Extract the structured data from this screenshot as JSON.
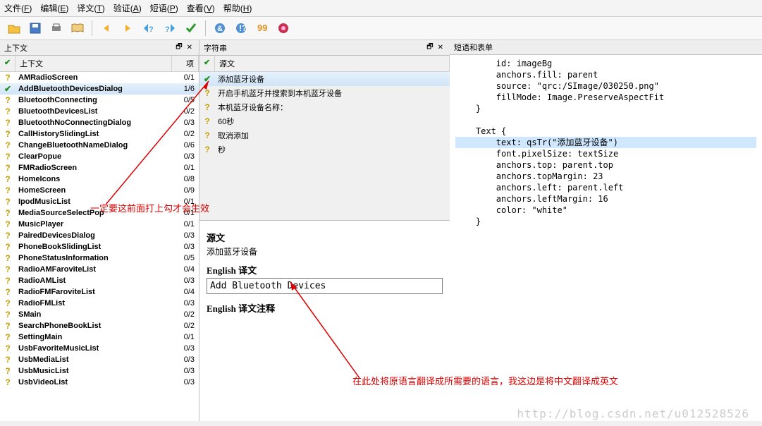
{
  "menu": [
    "文件(F)",
    "编辑(E)",
    "译文(T)",
    "验证(A)",
    "短语(P)",
    "查看(V)",
    "帮助(H)"
  ],
  "panels": {
    "context": {
      "title": "上下文",
      "col_icon": "",
      "col_name": "上下文",
      "col_items": "项"
    },
    "strings": {
      "title": "字符串",
      "col_icon": "",
      "col_name": "源文"
    },
    "right": {
      "title": "短语和表单"
    }
  },
  "context_rows": [
    {
      "icon": "q",
      "name": "AMRadioScreen",
      "items": "0/1"
    },
    {
      "icon": "c",
      "name": "AddBluetoothDevicesDialog",
      "items": "1/6",
      "sel": true
    },
    {
      "icon": "q",
      "name": "BluetoothConnecting",
      "items": "0/5"
    },
    {
      "icon": "q",
      "name": "BluetoothDevicesList",
      "items": "0/2"
    },
    {
      "icon": "q",
      "name": "BluetoothNoConnectingDialog",
      "items": "0/3"
    },
    {
      "icon": "q",
      "name": "CallHistorySlidingList",
      "items": "0/2"
    },
    {
      "icon": "q",
      "name": "ChangeBluetoothNameDialog",
      "items": "0/6"
    },
    {
      "icon": "q",
      "name": "ClearPopue",
      "items": "0/3"
    },
    {
      "icon": "q",
      "name": "FMRadioScreen",
      "items": "0/1"
    },
    {
      "icon": "q",
      "name": "HomeIcons",
      "items": "0/8"
    },
    {
      "icon": "q",
      "name": "HomeScreen",
      "items": "0/9"
    },
    {
      "icon": "q",
      "name": "IpodMusicList",
      "items": "0/1"
    },
    {
      "icon": "q",
      "name": "MediaSourceSelectPop",
      "items": "0/1"
    },
    {
      "icon": "q",
      "name": "MusicPlayer",
      "items": "0/1"
    },
    {
      "icon": "q",
      "name": "PairedDevicesDialog",
      "items": "0/3"
    },
    {
      "icon": "q",
      "name": "PhoneBookSlidingList",
      "items": "0/3"
    },
    {
      "icon": "q",
      "name": "PhoneStatusInformation",
      "items": "0/5"
    },
    {
      "icon": "q",
      "name": "RadioAMFaroviteList",
      "items": "0/4"
    },
    {
      "icon": "q",
      "name": "RadioAMList",
      "items": "0/3"
    },
    {
      "icon": "q",
      "name": "RadioFMFaroviteList",
      "items": "0/4"
    },
    {
      "icon": "q",
      "name": "RadioFMList",
      "items": "0/3"
    },
    {
      "icon": "q",
      "name": "SMain",
      "items": "0/2"
    },
    {
      "icon": "q",
      "name": "SearchPhoneBookList",
      "items": "0/2"
    },
    {
      "icon": "q",
      "name": "SettingMain",
      "items": "0/1"
    },
    {
      "icon": "q",
      "name": "UsbFavoriteMusicList",
      "items": "0/3"
    },
    {
      "icon": "q",
      "name": "UsbMediaList",
      "items": "0/3"
    },
    {
      "icon": "q",
      "name": "UsbMusicList",
      "items": "0/3"
    },
    {
      "icon": "q",
      "name": "UsbVideoList",
      "items": "0/3"
    }
  ],
  "string_rows": [
    {
      "icon": "c",
      "name": "添加蓝牙设备",
      "sel": true
    },
    {
      "icon": "q",
      "name": "开启手机蓝牙并搜索到本机蓝牙设备"
    },
    {
      "icon": "q",
      "name": "本机蓝牙设备名称："
    },
    {
      "icon": "q",
      "name": "60秒"
    },
    {
      "icon": "q",
      "name": "取消添加"
    },
    {
      "icon": "q",
      "name": "秒"
    }
  ],
  "code": "        id: imageBg\n        anchors.fill: parent\n        source: \"qrc:/SImage/030250.png\"\n        fillMode: Image.PreserveAspectFit\n    }\n\n    Text {\n        text: qsTr(\"添加蓝牙设备\")\n        font.pixelSize: textSize\n        anchors.top: parent.top\n        anchors.topMargin: 23\n        anchors.left: parent.left\n        anchors.leftMargin: 16\n        color: \"white\"\n    }",
  "code_hl_line": 7,
  "editor": {
    "src_label": "源文",
    "src_text": "添加蓝牙设备",
    "trans_label": "English 译文",
    "trans_value": "Add Bluetooth Devices",
    "comment_label": "English 译文注释"
  },
  "annotations": {
    "a1": "一定要这前面打上勾才会生效",
    "a2": "在此处将原语言翻译成所需要的语言，我这边是将中文翻译成英文"
  },
  "watermark": "http://blog.csdn.net/u012528526"
}
